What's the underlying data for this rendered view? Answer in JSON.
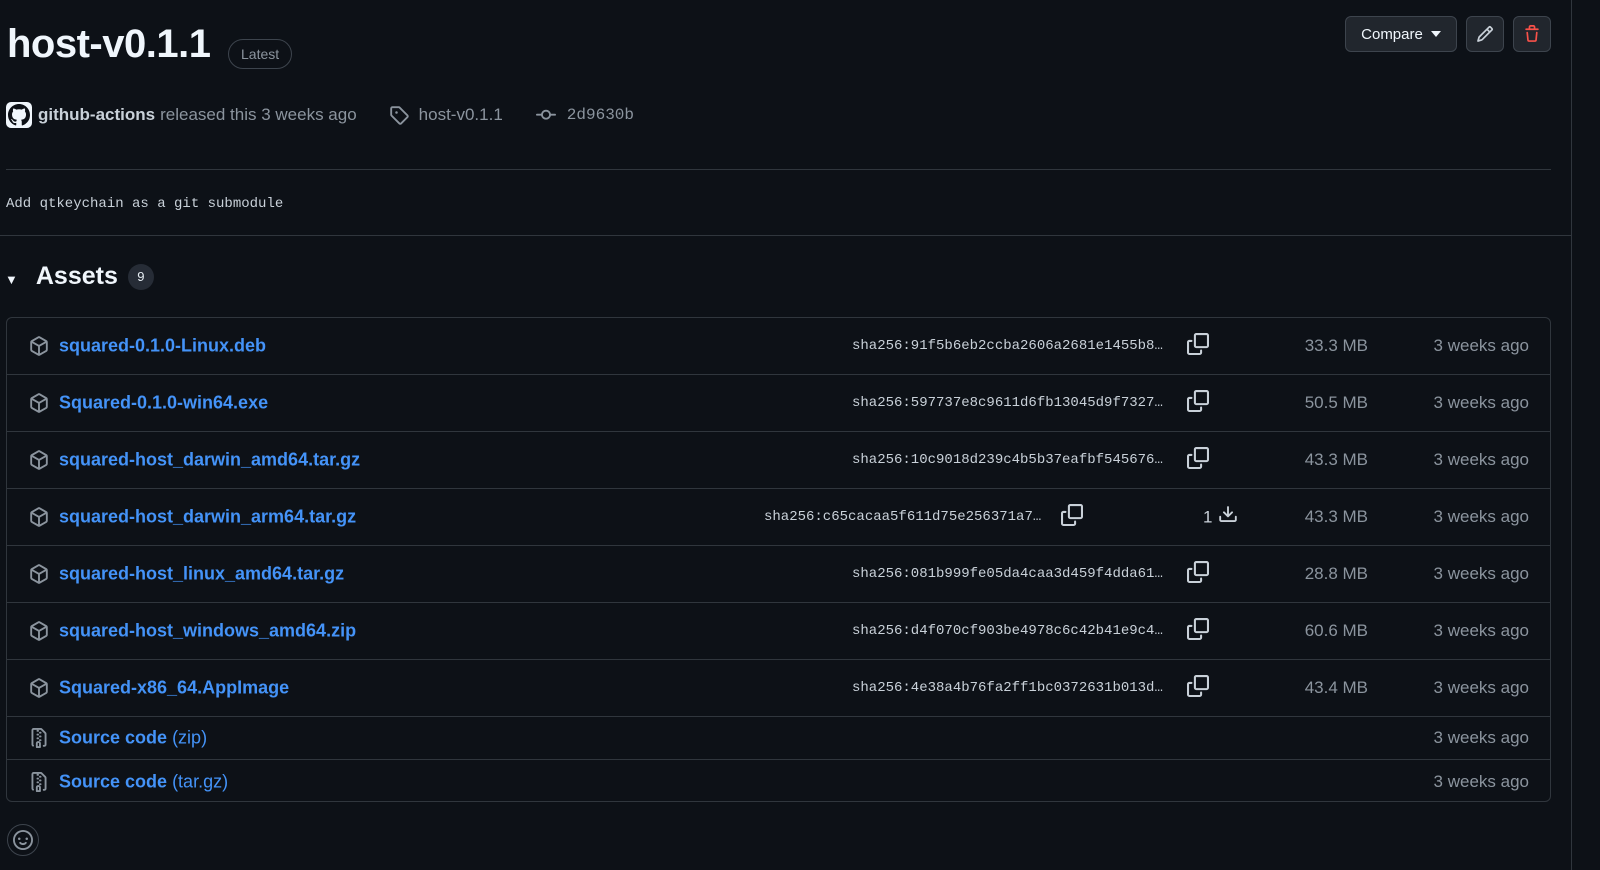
{
  "release": {
    "title": "host-v0.1.1",
    "badge": "Latest",
    "author": "github-actions",
    "released_text": "released this 3 weeks ago",
    "tag": "host-v0.1.1",
    "commit": "2d9630b",
    "description": "Add qtkeychain as a git submodule"
  },
  "actions": {
    "compare_label": "Compare",
    "edit_icon": "pencil-icon",
    "delete_icon": "trash-icon"
  },
  "assets": {
    "title": "Assets",
    "count": "9",
    "items": [
      {
        "name": "squared-0.1.0-Linux.deb",
        "sha": "sha256:91f5b6eb2ccba2606a2681e1455b8…",
        "downloads": "",
        "size": "33.3 MB",
        "date": "3 weeks ago"
      },
      {
        "name": "Squared-0.1.0-win64.exe",
        "sha": "sha256:597737e8c9611d6fb13045d9f7327…",
        "downloads": "",
        "size": "50.5 MB",
        "date": "3 weeks ago"
      },
      {
        "name": "squared-host_darwin_amd64.tar.gz",
        "sha": "sha256:10c9018d239c4b5b37eafbf545676…",
        "downloads": "",
        "size": "43.3 MB",
        "date": "3 weeks ago"
      },
      {
        "name": "squared-host_darwin_arm64.tar.gz",
        "sha": "sha256:c65cacaa5f611d75e256371a7…",
        "downloads": "1",
        "size": "43.3 MB",
        "date": "3 weeks ago"
      },
      {
        "name": "squared-host_linux_amd64.tar.gz",
        "sha": "sha256:081b999fe05da4caa3d459f4dda61…",
        "downloads": "",
        "size": "28.8 MB",
        "date": "3 weeks ago"
      },
      {
        "name": "squared-host_windows_amd64.zip",
        "sha": "sha256:d4f070cf903be4978c6c42b41e9c4…",
        "downloads": "",
        "size": "60.6 MB",
        "date": "3 weeks ago"
      },
      {
        "name": "Squared-x86_64.AppImage",
        "sha": "sha256:4e38a4b76fa2ff1bc0372631b013d…",
        "downloads": "",
        "size": "43.4 MB",
        "date": "3 weeks ago"
      }
    ],
    "source": [
      {
        "name": "Source code",
        "suffix": "(zip)",
        "date": "3 weeks ago"
      },
      {
        "name": "Source code",
        "suffix": "(tar.gz)",
        "date": "3 weeks ago"
      }
    ]
  },
  "colors": {
    "background": "#0d1117",
    "link": "#4493f8",
    "muted": "#8b949e",
    "border": "#30363d"
  }
}
